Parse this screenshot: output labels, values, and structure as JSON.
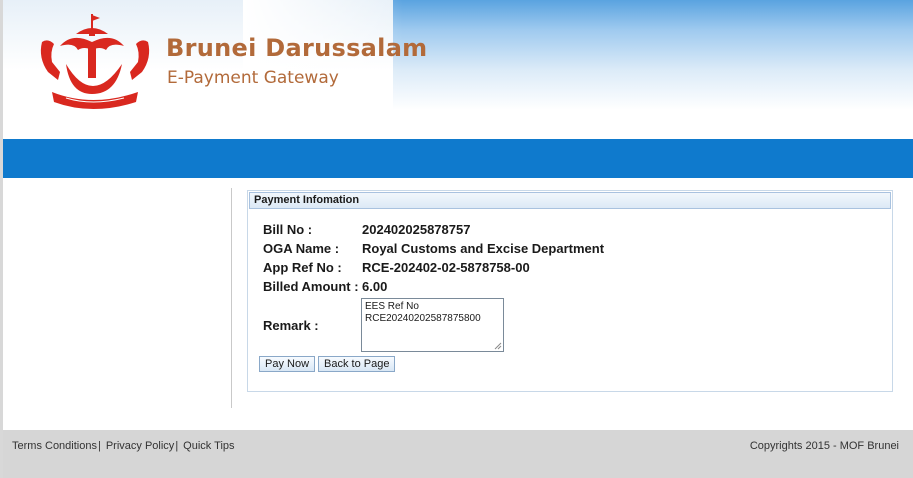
{
  "header": {
    "title": "Brunei Darussalam",
    "subtitle": "E-Payment Gateway",
    "crest_icon": "brunei-crest-icon"
  },
  "colors": {
    "brand_text": "#b26a3a",
    "nav_bar": "#0f7acd",
    "crest_red": "#d9281f",
    "footer_bg": "#d6d6d6"
  },
  "payment": {
    "panel_title": "Payment Infomation",
    "fields": [
      {
        "label": "Bill No :",
        "value": "202402025878757"
      },
      {
        "label": "OGA Name :",
        "value": "Royal Customs and Excise Department"
      },
      {
        "label": "App Ref No :",
        "value": "RCE-202402-02-5878758-00"
      },
      {
        "label": "Billed Amount :",
        "value": "6.00"
      }
    ],
    "remark_label": "Remark :",
    "remark_lines": [
      "EES Ref No",
      "RCE20240202587875800"
    ],
    "pay_now_label": "Pay Now",
    "back_label": "Back to Page"
  },
  "footer": {
    "links": [
      "Terms Conditions",
      "Privacy Policy",
      "Quick Tips"
    ],
    "separator": "|",
    "copyright": "Copyrights 2015 - MOF Brunei"
  }
}
